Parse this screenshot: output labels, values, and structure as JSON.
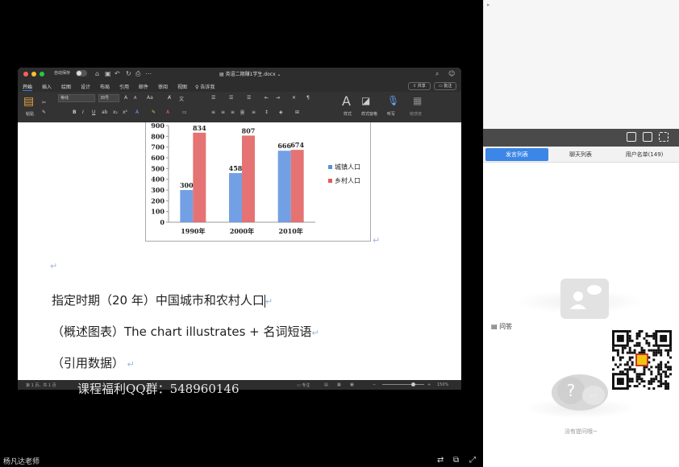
{
  "window": {
    "autosave_label": "自动保存",
    "doc_title": "英语二期赚1学生.docx",
    "menu": [
      "开始",
      "插入",
      "绘图",
      "设计",
      "布局",
      "引用",
      "邮件",
      "审阅",
      "视图"
    ],
    "tell_me": "告诉我",
    "share_label": "共享",
    "comment_label": "批注",
    "font_name": "等线",
    "font_size": "四号",
    "paste_label": "粘贴",
    "styles_label": "样式",
    "styles_pane_label": "样式窗格",
    "dictate_label": "听写",
    "sensitivity_label": "敏感度"
  },
  "chart_data": {
    "type": "bar",
    "categories": [
      "1990年",
      "2000年",
      "2010年"
    ],
    "series": [
      {
        "name": "城镇人口",
        "values": [
          300,
          458,
          666
        ],
        "color": "#5b8fe0"
      },
      {
        "name": "乡村人口",
        "values": [
          834,
          807,
          674
        ],
        "color": "#e05b5b"
      }
    ],
    "ylim": [
      0,
      900
    ],
    "yticks": [
      "0",
      "100",
      "200",
      "300",
      "400",
      "500",
      "600",
      "700",
      "800",
      "900"
    ],
    "legend_position": "right"
  },
  "document": {
    "line1": "指定时期（20 年）中国城市和农村人口",
    "line2": "（概述图表）The chart illustrates +  名词短语",
    "line3": "（引用数据）"
  },
  "statusbar": {
    "page_info": "第 1 页，共 1 页",
    "focus_label": "专注",
    "zoom": "150%"
  },
  "watermark": "课程福利QQ群：548960146",
  "teacher": "杨凡达老师",
  "right_panel": {
    "tabs": [
      "发言列表",
      "聊天列表",
      "用户名单(149)"
    ],
    "qa_label": "问答",
    "no_question": "没有提问哦~"
  }
}
